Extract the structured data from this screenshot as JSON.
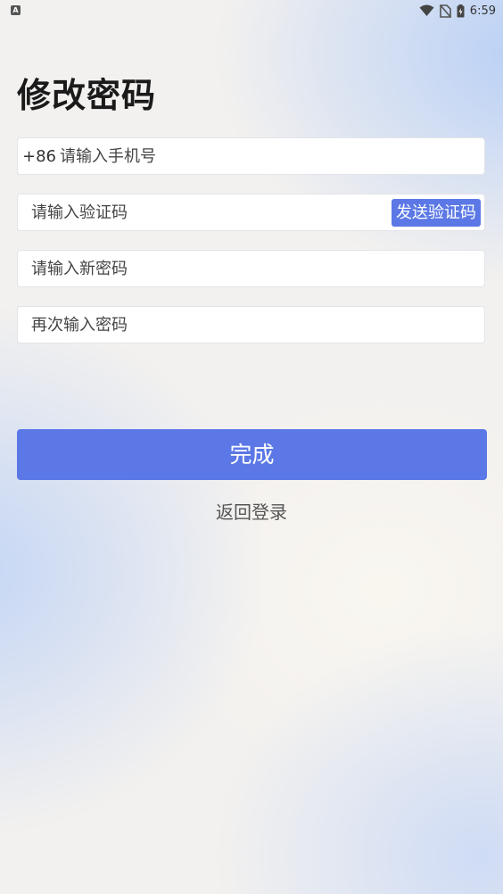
{
  "status_bar": {
    "left_icon": "A",
    "time": "6:59",
    "icons": [
      "wifi-icon",
      "no-sim-icon",
      "battery-icon"
    ]
  },
  "title": "修改密码",
  "phone_field": {
    "country_code": "+86",
    "placeholder": "请输入手机号",
    "value": ""
  },
  "code_field": {
    "placeholder": "请输入验证码",
    "value": "",
    "send_button_label": "发送验证码"
  },
  "new_password_field": {
    "placeholder": "请输入新密码",
    "value": ""
  },
  "confirm_password_field": {
    "placeholder": "再次输入密码",
    "value": ""
  },
  "submit_button_label": "完成",
  "back_to_login_label": "返回登录",
  "colors": {
    "accent": "#5b78e6",
    "title": "#1a1a1a"
  }
}
